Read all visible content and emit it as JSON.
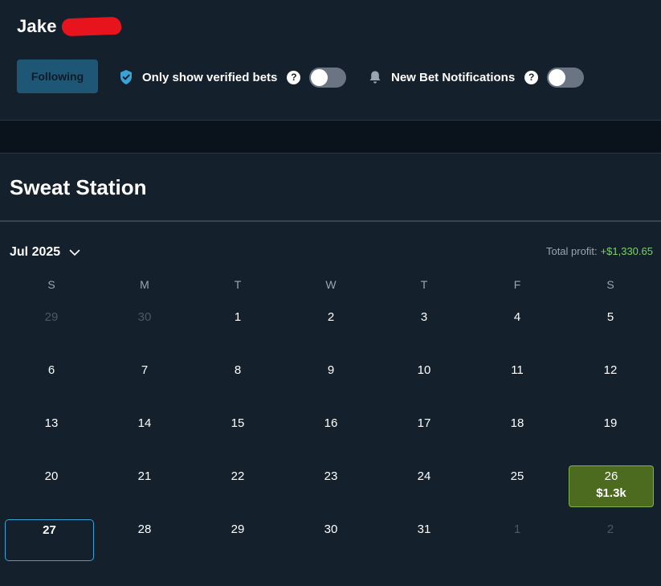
{
  "profile": {
    "first_name": "Jake"
  },
  "controls": {
    "following_label": "Following",
    "verified_label": "Only show verified bets",
    "verified_icon": "shield-check-icon",
    "notify_label": "New Bet Notifications",
    "notify_icon": "bell-icon",
    "help_glyph": "?",
    "verified_toggle_on": false,
    "notify_toggle_on": false
  },
  "section": {
    "title": "Sweat Station"
  },
  "calendar": {
    "month_label": "Jul 2025",
    "profit_label": "Total profit:",
    "profit_value": "+$1,330.65",
    "weekdays": [
      "S",
      "M",
      "T",
      "W",
      "T",
      "F",
      "S"
    ],
    "days": [
      {
        "n": "29",
        "muted": true
      },
      {
        "n": "30",
        "muted": true
      },
      {
        "n": "1"
      },
      {
        "n": "2"
      },
      {
        "n": "3"
      },
      {
        "n": "4"
      },
      {
        "n": "5"
      },
      {
        "n": "6"
      },
      {
        "n": "7"
      },
      {
        "n": "8"
      },
      {
        "n": "9"
      },
      {
        "n": "10"
      },
      {
        "n": "11"
      },
      {
        "n": "12"
      },
      {
        "n": "13"
      },
      {
        "n": "14"
      },
      {
        "n": "15"
      },
      {
        "n": "16"
      },
      {
        "n": "17"
      },
      {
        "n": "18"
      },
      {
        "n": "19"
      },
      {
        "n": "20"
      },
      {
        "n": "21"
      },
      {
        "n": "22"
      },
      {
        "n": "23"
      },
      {
        "n": "24"
      },
      {
        "n": "25"
      },
      {
        "n": "26",
        "amount": "$1.3k",
        "win": true
      },
      {
        "n": "27",
        "today": true
      },
      {
        "n": "28"
      },
      {
        "n": "29"
      },
      {
        "n": "30"
      },
      {
        "n": "31"
      },
      {
        "n": "1",
        "muted": true
      },
      {
        "n": "2",
        "muted": true
      }
    ]
  },
  "colors": {
    "background": "#15202d",
    "win_fill": "#4c6b1f",
    "profit_green": "#7bd16a",
    "today_border": "#3aa3d6",
    "button_blue": "#1e5776"
  }
}
